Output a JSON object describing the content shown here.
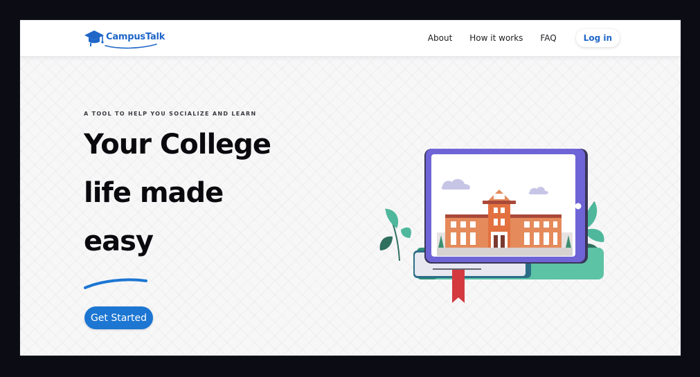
{
  "brand": {
    "name": "CampusTalk",
    "icon": "graduation-cap-icon",
    "color": "#1f66c8"
  },
  "nav": {
    "links": [
      "About",
      "How it works",
      "FAQ"
    ],
    "login_label": "Log in"
  },
  "hero": {
    "tagline": "A TOOL TO HELP YOU SOCIALIZE AND LEARN",
    "headline_lines": [
      "Your College",
      "life made",
      "easy"
    ],
    "cta_label": "Get Started",
    "accent": "#1c76d2"
  },
  "illustration": {
    "subject": "tablet showing a college building on top of books",
    "icon": "college-building-icon"
  }
}
